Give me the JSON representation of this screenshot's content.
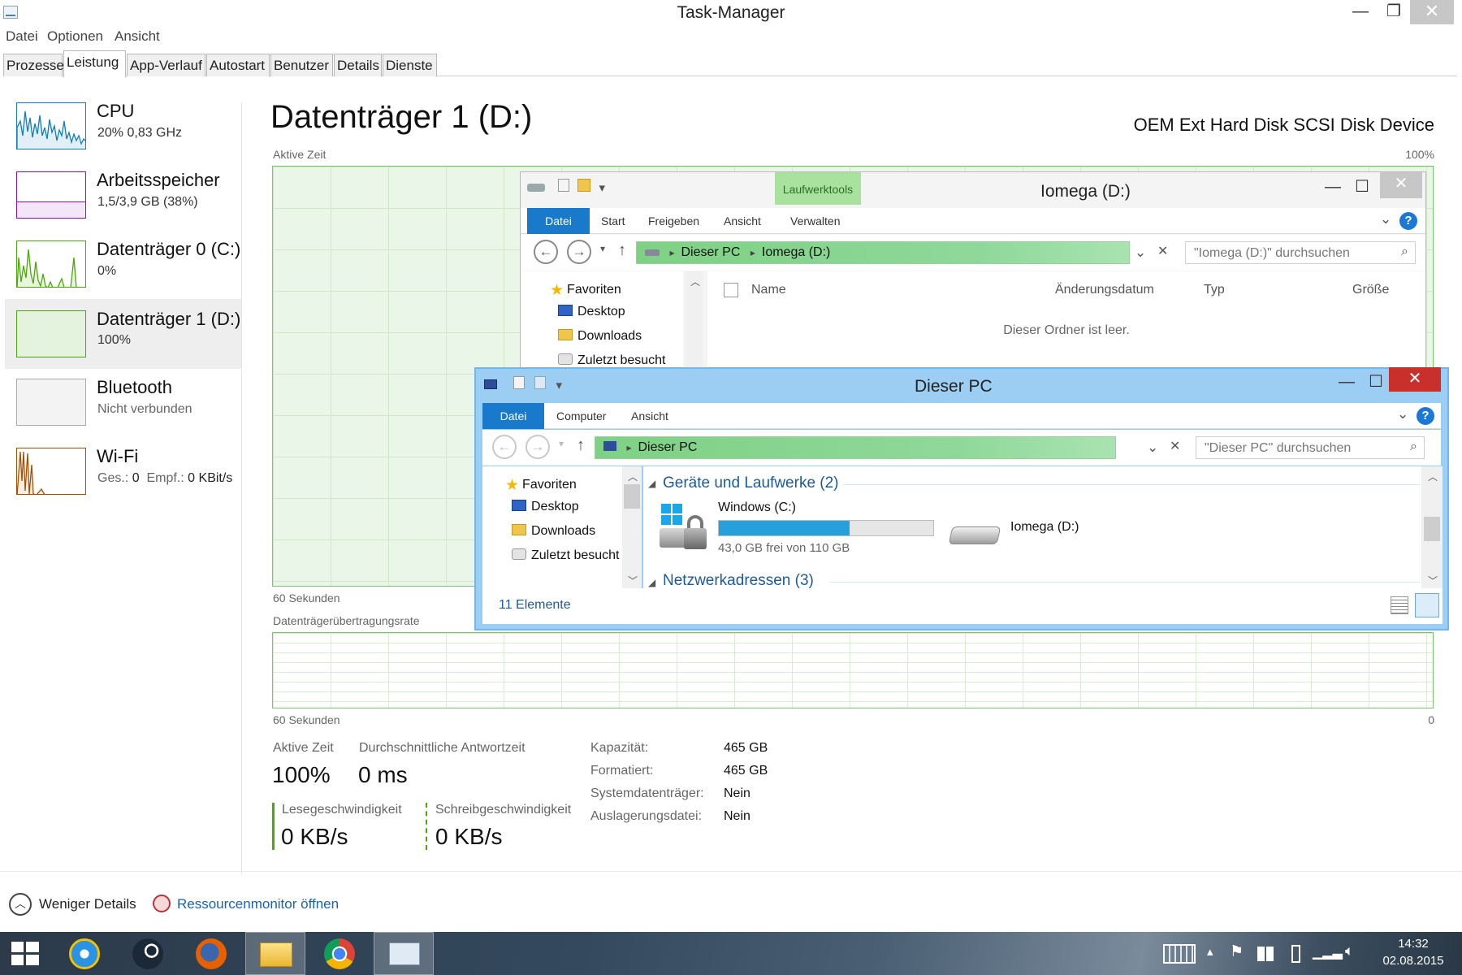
{
  "window": {
    "title": "Task-Manager"
  },
  "menu": [
    "Datei",
    "Optionen",
    "Ansicht"
  ],
  "tabs": [
    "Prozesse",
    "Leistung",
    "App-Verlauf",
    "Autostart",
    "Benutzer",
    "Details",
    "Dienste"
  ],
  "active_tab": "Leistung",
  "sidebar": {
    "items": [
      {
        "name": "CPU",
        "sub": "20%  0,83 GHz",
        "color": "#117dbb"
      },
      {
        "name": "Arbeitsspeicher",
        "sub": "1,5/3,9 GB (38%)",
        "color": "#8b12ae"
      },
      {
        "name": "Datenträger 0 (C:)",
        "sub": "0%",
        "color": "#4da60c"
      },
      {
        "name": "Datenträger 1 (D:)",
        "sub": "100%",
        "color": "#4da60c"
      },
      {
        "name": "Bluetooth",
        "sub": "Nicht verbunden",
        "color": "#888888"
      },
      {
        "name": "Wi-Fi",
        "sub_sent_label": "Ges.:",
        "sub_sent": "0",
        "sub_recv_label": "Empf.:",
        "sub_recv": "0 KBit/s",
        "color": "#a74f01"
      }
    ]
  },
  "disk": {
    "title": "Datenträger 1 (D:)",
    "device": "OEM  Ext Hard Disk SCSI Disk Device",
    "active_time_label": "Aktive Zeit",
    "max_label": "100%",
    "time_label": "60 Sekunden",
    "rate_label": "Datenträgerübertragungsrate",
    "rate_time_label": "60 Sekunden",
    "rate_min": "0",
    "stats": {
      "active_time_label": "Aktive Zeit",
      "active_time": "100%",
      "resp_label": "Durchschnittliche Antwortzeit",
      "resp": "0 ms",
      "read_label": "Lesegeschwindigkeit",
      "read": "0 KB/s",
      "write_label": "Schreibgeschwindigkeit",
      "write": "0 KB/s"
    },
    "props": [
      {
        "label": "Kapazität:",
        "value": "465 GB"
      },
      {
        "label": "Formatiert:",
        "value": "465 GB"
      },
      {
        "label": "Systemdatenträger:",
        "value": "Nein"
      },
      {
        "label": "Auslagerungsdatei:",
        "value": "Nein"
      }
    ]
  },
  "footer": {
    "fewer_details": "Weniger Details",
    "resmon": "Ressourcenmonitor öffnen"
  },
  "explorer_iomega": {
    "title": "Iomega (D:)",
    "context_tab": "Laufwerktools",
    "ribbon": [
      "Datei",
      "Start",
      "Freigeben",
      "Ansicht",
      "Verwalten"
    ],
    "path": [
      "Dieser PC",
      "Iomega (D:)"
    ],
    "search_placeholder": "\"Iomega (D:)\" durchsuchen",
    "nav": [
      "Favoriten",
      "Desktop",
      "Downloads",
      "Zuletzt besucht"
    ],
    "columns": [
      "Name",
      "Änderungsdatum",
      "Typ",
      "Größe"
    ],
    "empty": "Dieser Ordner ist leer."
  },
  "explorer_pc": {
    "title": "Dieser PC",
    "ribbon": [
      "Datei",
      "Computer",
      "Ansicht"
    ],
    "path": [
      "Dieser PC"
    ],
    "search_placeholder": "\"Dieser PC\" durchsuchen",
    "nav": [
      "Favoriten",
      "Desktop",
      "Downloads",
      "Zuletzt besucht"
    ],
    "group_devices": "Geräte und Laufwerke (2)",
    "group_network": "Netzwerkadressen (3)",
    "drive_c": {
      "name": "Windows (C:)",
      "free": "43,0 GB frei von 110 GB",
      "used_fraction": 0.61
    },
    "drive_d": {
      "name": "Iomega (D:)"
    },
    "status": "11 Elemente"
  },
  "taskbar": {
    "apps": [
      "start-icon",
      "internet-explorer-icon",
      "steam-icon",
      "firefox-icon",
      "file-explorer-icon",
      "chrome-icon",
      "task-manager-icon"
    ],
    "time": "14:32",
    "date": "02.08.2015"
  }
}
